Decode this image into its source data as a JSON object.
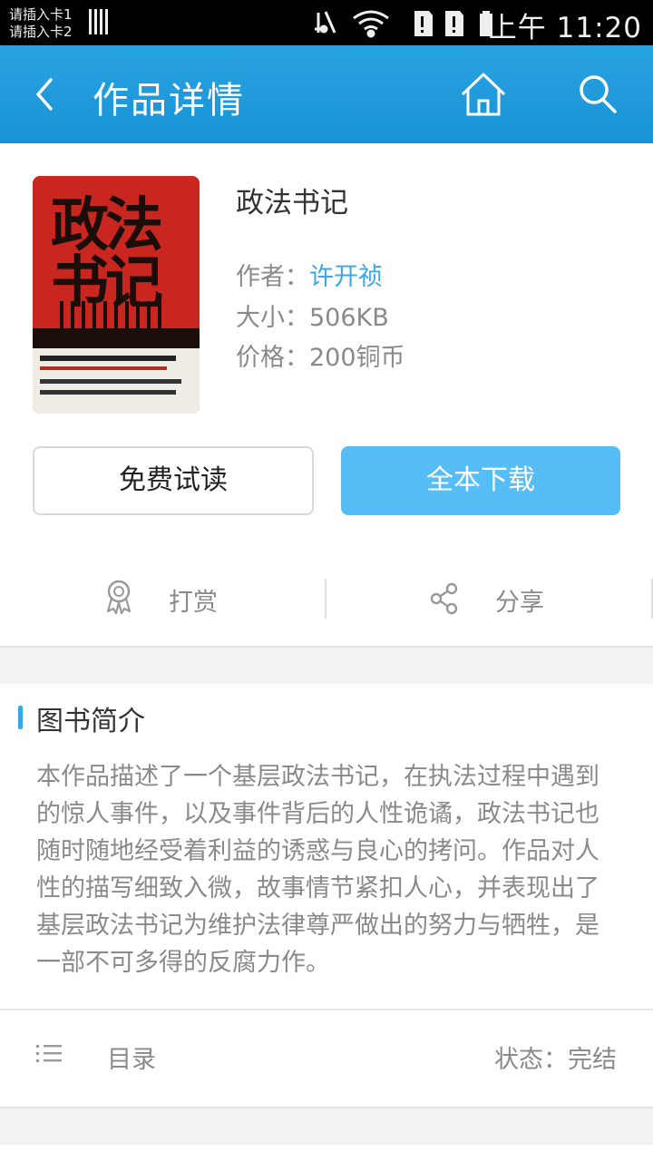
{
  "status_bar": {
    "sim1": "请插入卡1",
    "sim2": "请插入卡2",
    "time": "上午 11:20"
  },
  "header": {
    "title": "作品详情",
    "back_icon": "back-arrow-icon",
    "home_icon": "home-icon",
    "search_icon": "search-icon"
  },
  "book": {
    "title": "政法书记",
    "author_label": "作者：",
    "author": "许开祯",
    "size_label": "大小：",
    "size": "506KB",
    "price_label": "价格：",
    "price": "200铜币"
  },
  "buttons": {
    "free_read": "免费试读",
    "download": "全本下载"
  },
  "actions": {
    "reward": "打赏",
    "share": "分享"
  },
  "intro": {
    "title": "图书简介",
    "text": "本作品描述了一个基层政法书记，在执法过程中遇到的惊人事件，以及事件背后的人性诡谲，政法书记也随时随地经受着利益的诱惑与良心的拷问。作品对人性的描写细致入微，故事情节紧扣人心，并表现出了基层政法书记为维护法律尊严做出的努力与牺牲，是一部不可多得的反腐力作。"
  },
  "footer_row": {
    "toc": "目录",
    "status": "状态：完结"
  },
  "colors": {
    "header": "#1792d6",
    "accent": "#57bdf7",
    "link": "#3aa8e8",
    "cover_red": "#c8261e"
  }
}
